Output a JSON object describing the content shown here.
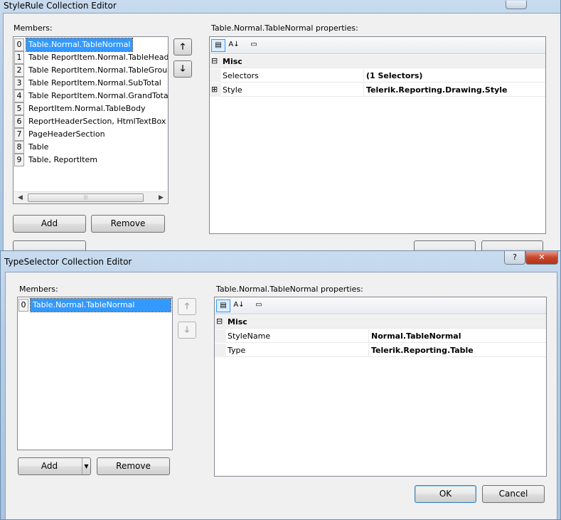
{
  "back_window": {
    "title": "StyleRule Collection Editor",
    "members_label": "Members:",
    "properties_label": "Table.Normal.TableNormal properties:",
    "members": [
      {
        "index": "0",
        "text": "Table.Normal.TableNormal",
        "selected": true
      },
      {
        "index": "1",
        "text": "Table ReportItem.Normal.TableHeade"
      },
      {
        "index": "2",
        "text": "Table ReportItem.Normal.TableGroup"
      },
      {
        "index": "3",
        "text": "Table ReportItem.Normal.SubTotal"
      },
      {
        "index": "4",
        "text": "Table ReportItem.Normal.GrandTotal"
      },
      {
        "index": "5",
        "text": "ReportItem.Normal.TableBody"
      },
      {
        "index": "6",
        "text": "ReportHeaderSection, HtmlTextBox"
      },
      {
        "index": "7",
        "text": "PageHeaderSection"
      },
      {
        "index": "8",
        "text": "Table"
      },
      {
        "index": "9",
        "text": "Table, ReportItem"
      }
    ],
    "move_up_icon": "arrow-up",
    "move_down_icon": "arrow-down",
    "add_label": "Add",
    "remove_label": "Remove",
    "category_expander": "⊟",
    "category": "Misc",
    "props": [
      {
        "name": "Selectors",
        "value": "(1 Selectors)",
        "expander": ""
      },
      {
        "name": "Style",
        "value": "Telerik.Reporting.Drawing.Style",
        "expander": "⊞"
      }
    ]
  },
  "front_window": {
    "title": "TypeSelector Collection Editor",
    "members_label": "Members:",
    "properties_label": "Table.Normal.TableNormal properties:",
    "members": [
      {
        "index": "0",
        "text": "Table.Normal.TableNormal",
        "selected": true
      }
    ],
    "add_label": "Add",
    "remove_label": "Remove",
    "category_expander": "⊟",
    "category": "Misc",
    "props": [
      {
        "name": "StyleName",
        "value": "Normal.TableNormal"
      },
      {
        "name": "Type",
        "value": "Telerik.Reporting.Table"
      }
    ],
    "ok_label": "OK",
    "cancel_label": "Cancel",
    "help_glyph": "?",
    "close_glyph": "✕"
  },
  "colors": {
    "selection": "#3399ff",
    "frame": "#b5cde6",
    "close": "#c7462d"
  }
}
